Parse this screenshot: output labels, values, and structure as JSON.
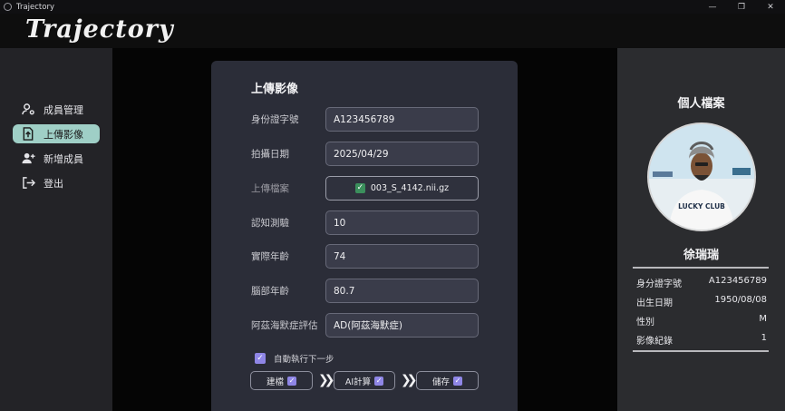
{
  "window": {
    "title": "Trajectory",
    "controls": [
      "—",
      "❐",
      "✕"
    ]
  },
  "header": {
    "logo": "Trajectory"
  },
  "sidebar": {
    "items": [
      {
        "label": "成員管理",
        "icon": "member-manage-icon",
        "active": false
      },
      {
        "label": "上傳影像",
        "icon": "upload-file-icon",
        "active": true
      },
      {
        "label": "新增成員",
        "icon": "add-user-icon",
        "active": false
      },
      {
        "label": "登出",
        "icon": "logout-icon",
        "active": false
      }
    ]
  },
  "form": {
    "title": "上傳影像",
    "id_label": "身份證字號",
    "id_value": "A123456789",
    "date_label": "拍攝日期",
    "date_value": "2025/04/29",
    "file_label": "上傳檔案",
    "file_value": "003_S_4142.nii.gz",
    "cognitive_label": "認知測驗",
    "cognitive_value": "10",
    "age_label": "實際年齡",
    "age_value": "74",
    "brain_age_label": "腦部年齡",
    "brain_age_value": "80.7",
    "ad_label": "阿茲海默症評估",
    "ad_value": "AD(阿茲海默症)",
    "auto_label": "自動執行下一步",
    "auto_checked": true,
    "steps": [
      {
        "label": "建檔",
        "checked": true
      },
      {
        "label": "AI計算",
        "checked": true
      },
      {
        "label": "儲存",
        "checked": true
      }
    ]
  },
  "profile": {
    "title": "個人檔案",
    "name": "徐瑞瑞",
    "shirt_text": "LUCKY CLUB",
    "rows": [
      {
        "key": "身分證字號",
        "value": "A123456789"
      },
      {
        "key": "出生日期",
        "value": "1950/08/08"
      },
      {
        "key": "性別",
        "value": "M"
      },
      {
        "key": "影像紀錄",
        "value": "1"
      }
    ]
  },
  "colors": {
    "active_nav": "#9fcfc6",
    "checkbox": "#8f86e6",
    "file_check": "#3b8f5c",
    "card": "#2b2d38"
  }
}
